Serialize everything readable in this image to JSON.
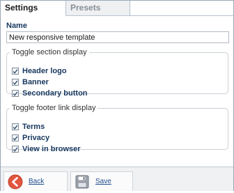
{
  "tabs": [
    {
      "label": "Settings",
      "active": true
    },
    {
      "label": "Presets",
      "active": false
    }
  ],
  "name_field": {
    "label": "Name",
    "value": "New responsive template"
  },
  "section_display": {
    "legend": "Toggle section display",
    "options": [
      {
        "label": "Header logo",
        "checked": true
      },
      {
        "label": "Banner",
        "checked": true
      },
      {
        "label": "Secondary button",
        "checked": true
      }
    ]
  },
  "footer_links": {
    "legend": "Toggle footer link display",
    "options": [
      {
        "label": "Terms",
        "checked": true
      },
      {
        "label": "Privacy",
        "checked": true
      },
      {
        "label": "View in browser",
        "checked": true
      }
    ]
  },
  "footer": {
    "back_label": "Back",
    "save_label": "Save",
    "back_icon": "back-arrow-icon",
    "save_icon": "floppy-disk-icon",
    "accent": "#e2553f"
  }
}
